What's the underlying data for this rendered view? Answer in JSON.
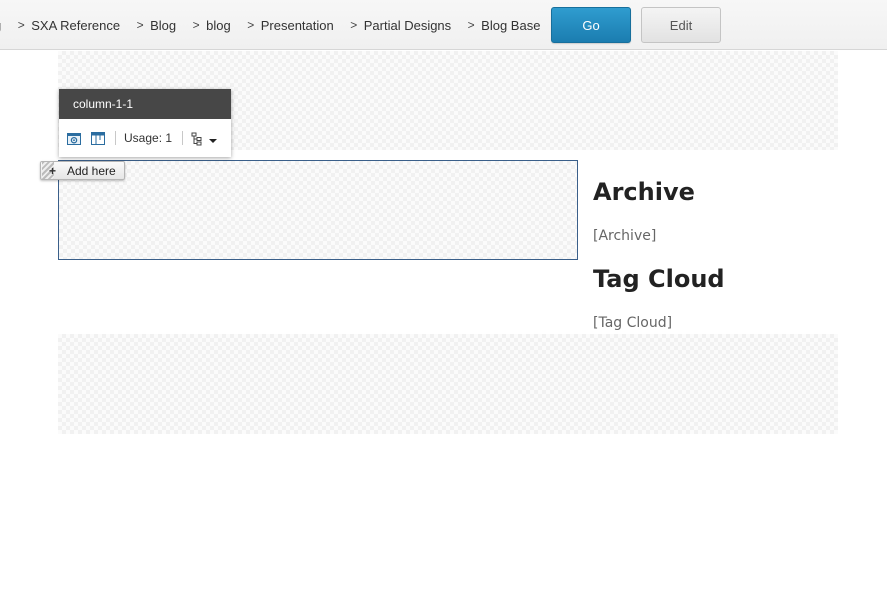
{
  "breadcrumb": {
    "items": [
      {
        "label": "g"
      },
      {
        "label": "SXA Reference"
      },
      {
        "label": "Blog"
      },
      {
        "label": "blog"
      },
      {
        "label": "Presentation"
      },
      {
        "label": "Partial Designs"
      },
      {
        "label": "Blog Base"
      }
    ],
    "separator": ">"
  },
  "toolbar": {
    "go_label": "Go",
    "edit_label": "Edit"
  },
  "chrome": {
    "title": "column-1-1",
    "usage_label": "Usage: 1"
  },
  "add_here": {
    "label": "Add here",
    "icon": "+"
  },
  "sidebar": {
    "archive_title": "Archive",
    "archive_placeholder": "[Archive]",
    "tagcloud_title": "Tag Cloud",
    "tagcloud_placeholder": "[Tag Cloud]"
  },
  "colors": {
    "go_button": "#1f86ba",
    "chrome_header": "#474747",
    "column_border": "#3a5f8a"
  }
}
